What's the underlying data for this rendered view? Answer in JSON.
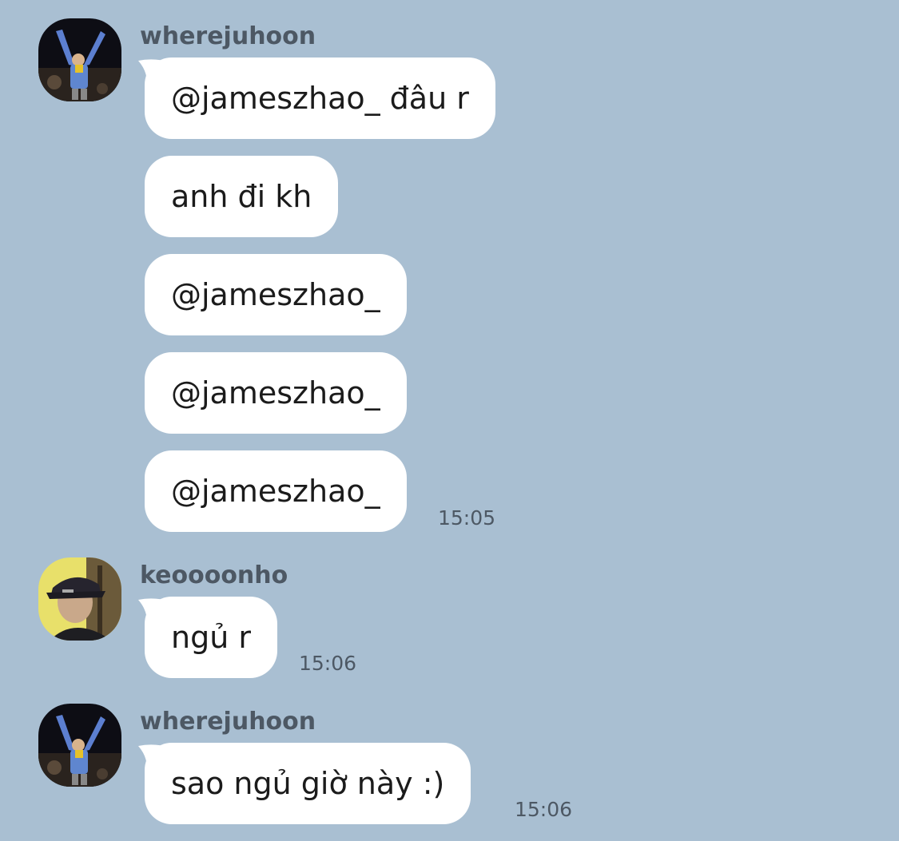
{
  "chat": {
    "groups": [
      {
        "username": "wherejuhoon",
        "avatar": "wherejuhoon-avatar",
        "messages": [
          {
            "text": "@jameszhao_ đâu r"
          },
          {
            "text": "anh đi kh"
          },
          {
            "text": "@jameszhao_"
          },
          {
            "text": "@jameszhao_"
          },
          {
            "text": "@jameszhao_",
            "time": "15:05"
          }
        ]
      },
      {
        "username": "keoooonho",
        "avatar": "keoooonho-avatar",
        "messages": [
          {
            "text": "ngủ r",
            "time": "15:06"
          }
        ]
      },
      {
        "username": "wherejuhoon",
        "avatar": "wherejuhoon-avatar",
        "messages": [
          {
            "text": "sao ngủ giờ này :)",
            "time": "15:06"
          }
        ]
      }
    ]
  },
  "colors": {
    "background": "#a9bfd2",
    "bubble": "#ffffff",
    "meta_text": "#4d5864",
    "message_text": "#1b1b1b"
  }
}
